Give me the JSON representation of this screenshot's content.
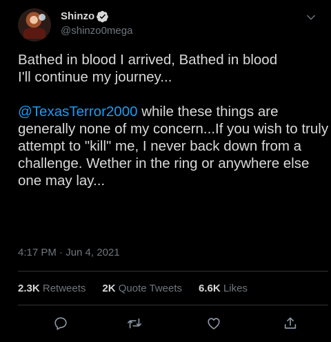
{
  "user": {
    "display_name": "Shinzo",
    "handle": "@shinzo0mega",
    "verified": true
  },
  "tweet": {
    "para1": "Bathed in blood I arrived, Bathed in blood\nI'll continue my journey...",
    "mention": "@TexasTerror2000",
    "para2_rest": " while these things are generally none of my concern...If you wish to truly attempt to \"kill\" me, I never back down from a challenge. Wether in the ring or anywhere else one may lay...",
    "timestamp": "4:17 PM · Jun 4, 2021"
  },
  "stats": {
    "retweets_count": "2.3K",
    "retweets_label": "Retweets",
    "quotes_count": "2K",
    "quotes_label": "Quote Tweets",
    "likes_count": "6.6K",
    "likes_label": "Likes"
  },
  "actions": {
    "reply": "reply-icon",
    "retweet": "retweet-icon",
    "like": "heart-icon",
    "share": "share-icon"
  },
  "colors": {
    "background": "#000000",
    "text": "#d9d9d9",
    "secondary": "#6e767d",
    "link": "#1d9bf0",
    "divider": "#2f3336"
  }
}
